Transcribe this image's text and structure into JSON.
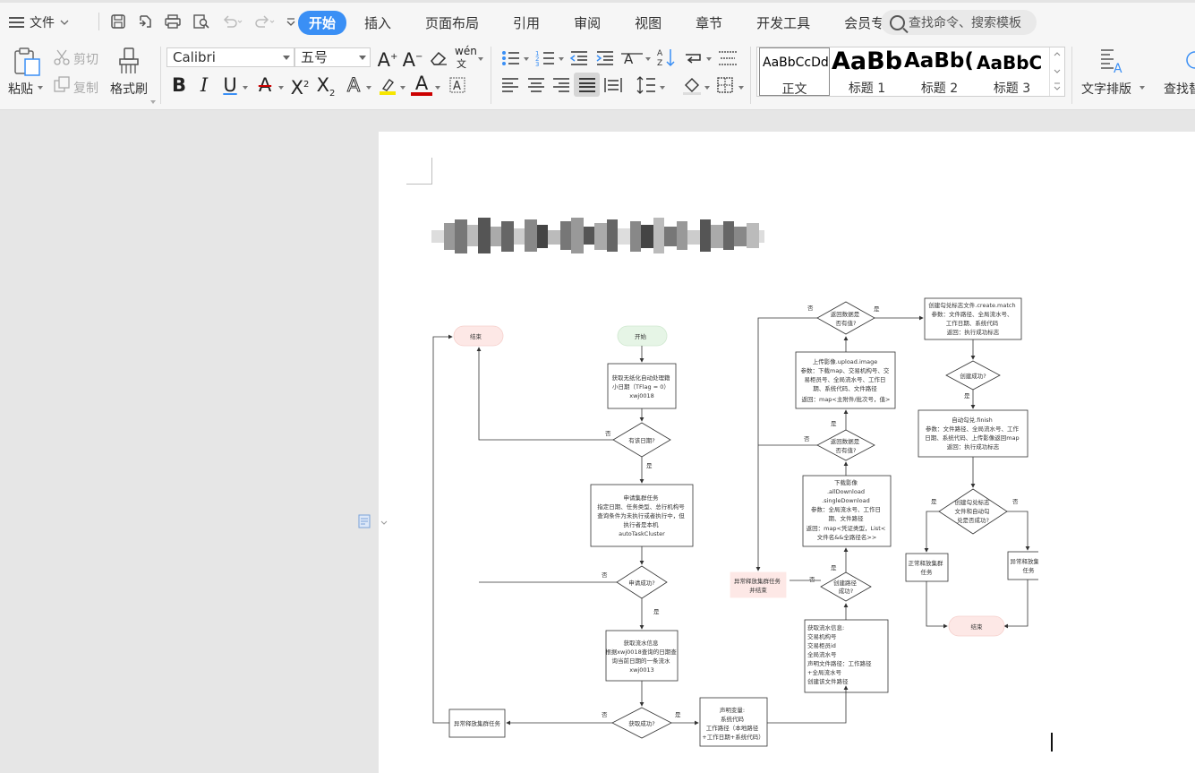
{
  "menu": {
    "label": "文件"
  },
  "tabs": [
    {
      "label": "开始",
      "active": true
    },
    {
      "label": "插入"
    },
    {
      "label": "页面布局"
    },
    {
      "label": "引用"
    },
    {
      "label": "审阅"
    },
    {
      "label": "视图"
    },
    {
      "label": "章节"
    },
    {
      "label": "开发工具"
    },
    {
      "label": "会员专享"
    }
  ],
  "search": {
    "placeholder": "查找命令、搜索模板"
  },
  "ribbon": {
    "paste": "粘贴",
    "cut": "剪切",
    "copy": "复制",
    "format_painter": "格式刷",
    "font_name": "Calibri",
    "font_size": "五号",
    "pinyin": "wén",
    "styles": [
      {
        "sample": "AaBbCcDd",
        "name": "正文"
      },
      {
        "sample": "AaBb",
        "name": "标题 1"
      },
      {
        "sample": "AaBb(",
        "name": "标题 2"
      },
      {
        "sample": "AaBbC",
        "name": "标题 3"
      }
    ],
    "text_layout": "文字排版",
    "find_replace": "查找替"
  },
  "flowchart": {
    "n_end1": "结束",
    "n_start": "开始",
    "n_get_flag": [
      "获取无纸化自动处理籍",
      "小日期（TFlag = 0）",
      "xwj0018"
    ],
    "d_has_date": "有该日期?",
    "n_apply": [
      "申请集群任务",
      "指定日期、任务类型、总行机构号",
      "查询条件为未执行或者执行中，但",
      "执行者是本机",
      "autoTaskCluster"
    ],
    "d_apply_ok": "申请成功?",
    "n_get_flow": [
      "获取流水信息",
      "根据xwj0018查询的日期查",
      "询当前日期的一条流水",
      "xwj0013"
    ],
    "d_get_ok": "获取成功?",
    "n_release_left": "异常释放集群任务",
    "n_declare": [
      "声明变量:",
      "系统代码",
      "工作路径（本地路径",
      "+工作日期+系统代码）"
    ],
    "n_flow_info": [
      "获取流水信息:",
      "交易机构号",
      "交易柜员id",
      "全局流水号",
      "声明文件路径：工作路径",
      "+全局流水号",
      "创建该文件路径"
    ],
    "d_create_path": [
      "创建路径",
      "成功?"
    ],
    "n_release_mid": [
      "异常释放集群任务",
      "并结束"
    ],
    "n_download": [
      "下载影像",
      ".allDownload",
      ".singleDownload",
      "参数：全局流水号、工作日",
      "期、文件路径",
      "返回：map<凭证类型，List<",
      "文件名&&全路径名>>"
    ],
    "d_return1": [
      "返回数据是",
      "否有值?"
    ],
    "n_upload": [
      "上传影像.upload.image",
      "参数：下载map、交易机构号、交",
      "易柜员号、全局流水号、工作日",
      "期、系统代码、文件路径",
      "返回：map<主附件/批次号，值>"
    ],
    "d_return2": [
      "返回数据是",
      "否有值?"
    ],
    "n_create_match": [
      "创建勾兑标志文件.create.match",
      "参数：文件路径、全局流水号、",
      "工作日期、系统代码",
      "返回：执行成功标志"
    ],
    "d_create_ok": "创建成功?",
    "n_finish": [
      "自动勾兑.finish",
      "参数：文件路径、全局流水号、工作",
      "日期、系统代码、上传影像返回map",
      "返回：执行成功标志"
    ],
    "d_finish_ok": [
      "创建勾兑标志",
      "文件和自动勾",
      "兑是否成功?"
    ],
    "n_release_ok": [
      "正常释放集群",
      "任务"
    ],
    "n_release_err": [
      "异常释放集群",
      "任务"
    ],
    "n_end2": "结束",
    "yes": "是",
    "no": "否"
  },
  "colors": {
    "accent": "#3a8ff5",
    "terminal_red": "#fde8e6",
    "terminal_green": "#e6f5e6",
    "release_fill": "#fde8e6"
  }
}
